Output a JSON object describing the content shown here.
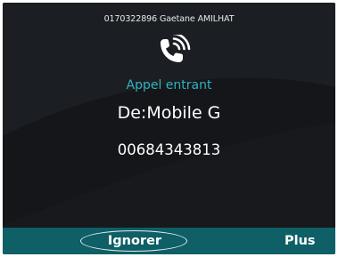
{
  "status_bar": {
    "line_text": "0170322896 Gaetane AMILHAT"
  },
  "call": {
    "icon": "incoming-call-phone-icon",
    "state": "Appel entrant",
    "caller": "De:Mobile G",
    "number": "00684343813"
  },
  "softkeys": {
    "ignore_label": "Ignorer",
    "more_label": "Plus"
  },
  "colors": {
    "background": "#141619",
    "accent": "#2fb2bf",
    "softkey_bar": "#0e5f66",
    "text": "#ffffff"
  }
}
